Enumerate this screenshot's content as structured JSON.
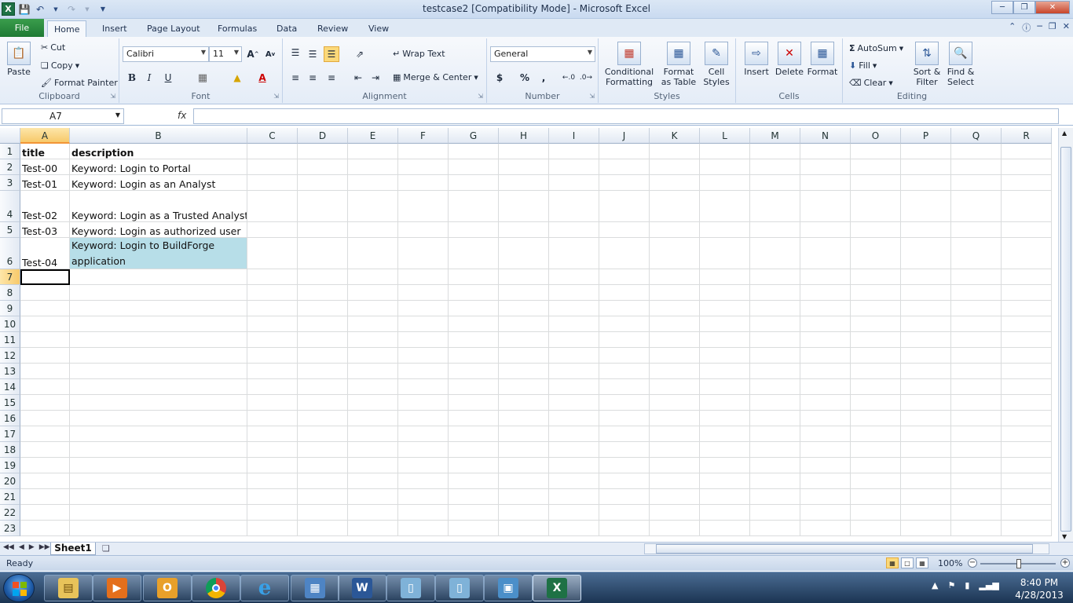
{
  "window": {
    "title": "testcase2  [Compatibility Mode]  -  Microsoft Excel"
  },
  "tabs": {
    "file": "File",
    "items": [
      "Home",
      "Insert",
      "Page Layout",
      "Formulas",
      "Data",
      "Review",
      "View"
    ],
    "active": "Home"
  },
  "ribbon": {
    "clipboard": {
      "label": "Clipboard",
      "paste": "Paste",
      "cut": "Cut",
      "copy": "Copy",
      "format_painter": "Format Painter"
    },
    "font": {
      "label": "Font",
      "name": "Calibri",
      "size": "11"
    },
    "alignment": {
      "label": "Alignment",
      "wrap": "Wrap Text",
      "merge": "Merge & Center"
    },
    "number": {
      "label": "Number",
      "format": "General",
      "currency": "$",
      "percent": "%",
      "comma": ","
    },
    "styles": {
      "label": "Styles",
      "conditional": [
        "Conditional",
        "Formatting"
      ],
      "format_table": [
        "Format",
        "as Table"
      ],
      "cell_styles": [
        "Cell",
        "Styles"
      ]
    },
    "cells": {
      "label": "Cells",
      "insert": "Insert",
      "delete": "Delete",
      "format": "Format"
    },
    "editing": {
      "label": "Editing",
      "autosum": "AutoSum",
      "fill": "Fill",
      "clear": "Clear",
      "sort": [
        "Sort &",
        "Filter"
      ],
      "find": [
        "Find &",
        "Select"
      ]
    }
  },
  "formula_bar": {
    "name_box": "A7",
    "fx": "fx",
    "value": ""
  },
  "columns": [
    "A",
    "B",
    "C",
    "D",
    "E",
    "F",
    "G",
    "H",
    "I",
    "J",
    "K",
    "L",
    "M",
    "N",
    "O",
    "P",
    "Q",
    "R"
  ],
  "rows": [
    "1",
    "2",
    "3",
    "4",
    "5",
    "6",
    "7",
    "8",
    "9",
    "10",
    "11",
    "12",
    "13",
    "14",
    "15",
    "16",
    "17",
    "18",
    "19",
    "20",
    "21",
    "22",
    "23"
  ],
  "cells": {
    "r1": {
      "a": "title",
      "b": "description"
    },
    "r2": {
      "a": "Test-00",
      "b": "Keyword: Login to Portal"
    },
    "r3": {
      "a": "Test-01",
      "b": "Keyword: Login as an Analyst"
    },
    "r4": {
      "a": "Test-02",
      "b": "Keyword: Login as a Trusted Analyst"
    },
    "r5": {
      "a": "Test-03",
      "b": "Keyword: Login as authorized user"
    },
    "r6": {
      "a": "Test-04",
      "b": "Keyword: Login to BuildForge application"
    }
  },
  "sheet": {
    "tab": "Sheet1"
  },
  "status": {
    "ready": "Ready",
    "zoom": "100%"
  },
  "taskbar": {
    "time": "8:40 PM",
    "date": "4/28/2013"
  },
  "colors": {
    "selection_fill": "#b7dee8",
    "file_tab": "#2a8a3e",
    "header_selected": "#f7c96a"
  }
}
